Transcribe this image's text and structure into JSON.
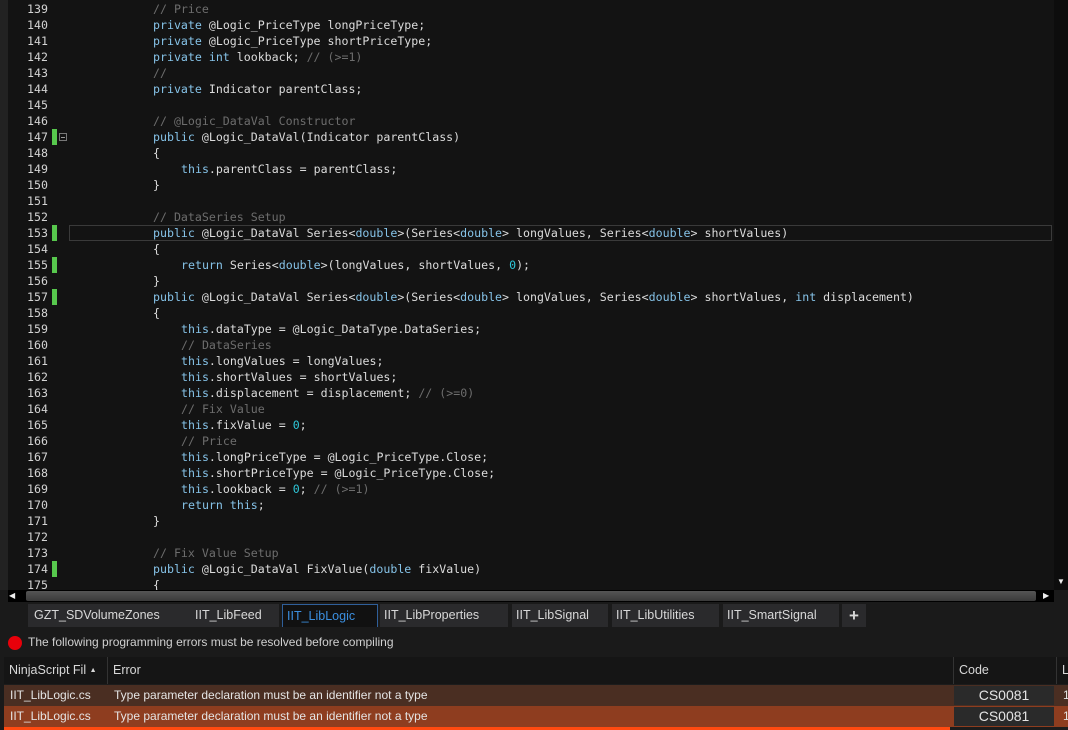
{
  "editor": {
    "lines": [
      {
        "n": "139",
        "i": 12,
        "t": [
          [
            "cm",
            "// Price"
          ]
        ]
      },
      {
        "n": "140",
        "i": 12,
        "t": [
          [
            "kw",
            "private"
          ],
          [
            "tx",
            " @Logic_PriceType longPriceType;"
          ]
        ]
      },
      {
        "n": "141",
        "i": 12,
        "t": [
          [
            "kw",
            "private"
          ],
          [
            "tx",
            " @Logic_PriceType shortPriceType;"
          ]
        ]
      },
      {
        "n": "142",
        "i": 12,
        "t": [
          [
            "kw",
            "private int"
          ],
          [
            "tx",
            " lookback; "
          ],
          [
            "cm",
            "// (>=1)"
          ]
        ]
      },
      {
        "n": "143",
        "i": 12,
        "t": [
          [
            "cm",
            "//"
          ]
        ]
      },
      {
        "n": "144",
        "i": 12,
        "t": [
          [
            "kw",
            "private"
          ],
          [
            "tx",
            " Indicator parentClass;"
          ]
        ]
      },
      {
        "n": "145",
        "i": 0,
        "t": []
      },
      {
        "n": "146",
        "i": 12,
        "t": [
          [
            "cm",
            "// @Logic_DataVal Constructor"
          ]
        ]
      },
      {
        "n": "147",
        "i": 12,
        "mark": true,
        "fold": true,
        "t": [
          [
            "kw",
            "public"
          ],
          [
            "tx",
            " @Logic_DataVal(Indicator parentClass)"
          ]
        ]
      },
      {
        "n": "148",
        "i": 12,
        "t": [
          [
            "tx",
            "{"
          ]
        ]
      },
      {
        "n": "149",
        "i": 16,
        "t": [
          [
            "kw",
            "this"
          ],
          [
            "tx",
            ".parentClass = parentClass;"
          ]
        ]
      },
      {
        "n": "150",
        "i": 12,
        "t": [
          [
            "tx",
            "}"
          ]
        ]
      },
      {
        "n": "151",
        "i": 0,
        "t": []
      },
      {
        "n": "152",
        "i": 12,
        "t": [
          [
            "cm",
            "// DataSeries Setup"
          ]
        ]
      },
      {
        "n": "153",
        "i": 12,
        "mark": true,
        "current": true,
        "t": [
          [
            "kw",
            "public"
          ],
          [
            "tx",
            " @Logic_DataVal Series<"
          ],
          [
            "kw",
            "double"
          ],
          [
            "tx",
            ">(Series<"
          ],
          [
            "kw",
            "double"
          ],
          [
            "tx",
            "> longValues, Series<"
          ],
          [
            "kw",
            "double"
          ],
          [
            "tx",
            "> shortValues)"
          ]
        ]
      },
      {
        "n": "154",
        "i": 12,
        "t": [
          [
            "tx",
            "{"
          ]
        ]
      },
      {
        "n": "155",
        "i": 16,
        "mark": true,
        "t": [
          [
            "kw",
            "return"
          ],
          [
            "tx",
            " Series<"
          ],
          [
            "kw",
            "double"
          ],
          [
            "tx",
            ">(longValues, shortValues, "
          ],
          [
            "num",
            "0"
          ],
          [
            "tx",
            ");"
          ]
        ]
      },
      {
        "n": "156",
        "i": 12,
        "t": [
          [
            "tx",
            "}"
          ]
        ]
      },
      {
        "n": "157",
        "i": 12,
        "mark": true,
        "t": [
          [
            "kw",
            "public"
          ],
          [
            "tx",
            " @Logic_DataVal Series<"
          ],
          [
            "kw",
            "double"
          ],
          [
            "tx",
            ">(Series<"
          ],
          [
            "kw",
            "double"
          ],
          [
            "tx",
            "> longValues, Series<"
          ],
          [
            "kw",
            "double"
          ],
          [
            "tx",
            "> shortValues, "
          ],
          [
            "kw",
            "int"
          ],
          [
            "tx",
            " displacement)"
          ]
        ]
      },
      {
        "n": "158",
        "i": 12,
        "t": [
          [
            "tx",
            "{"
          ]
        ]
      },
      {
        "n": "159",
        "i": 16,
        "t": [
          [
            "kw",
            "this"
          ],
          [
            "tx",
            ".dataType = @Logic_DataType.DataSeries;"
          ]
        ]
      },
      {
        "n": "160",
        "i": 16,
        "t": [
          [
            "cm",
            "// DataSeries"
          ]
        ]
      },
      {
        "n": "161",
        "i": 16,
        "t": [
          [
            "kw",
            "this"
          ],
          [
            "tx",
            ".longValues = longValues;"
          ]
        ]
      },
      {
        "n": "162",
        "i": 16,
        "t": [
          [
            "kw",
            "this"
          ],
          [
            "tx",
            ".shortValues = shortValues;"
          ]
        ]
      },
      {
        "n": "163",
        "i": 16,
        "t": [
          [
            "kw",
            "this"
          ],
          [
            "tx",
            ".displacement = displacement; "
          ],
          [
            "cm",
            "// (>=0)"
          ]
        ]
      },
      {
        "n": "164",
        "i": 16,
        "t": [
          [
            "cm",
            "// Fix Value"
          ]
        ]
      },
      {
        "n": "165",
        "i": 16,
        "t": [
          [
            "kw",
            "this"
          ],
          [
            "tx",
            ".fixValue = "
          ],
          [
            "num",
            "0"
          ],
          [
            "tx",
            ";"
          ]
        ]
      },
      {
        "n": "166",
        "i": 16,
        "t": [
          [
            "cm",
            "// Price"
          ]
        ]
      },
      {
        "n": "167",
        "i": 16,
        "t": [
          [
            "kw",
            "this"
          ],
          [
            "tx",
            ".longPriceType = @Logic_PriceType.Close;"
          ]
        ]
      },
      {
        "n": "168",
        "i": 16,
        "t": [
          [
            "kw",
            "this"
          ],
          [
            "tx",
            ".shortPriceType = @Logic_PriceType.Close;"
          ]
        ]
      },
      {
        "n": "169",
        "i": 16,
        "t": [
          [
            "kw",
            "this"
          ],
          [
            "tx",
            ".lookback = "
          ],
          [
            "num",
            "0"
          ],
          [
            "tx",
            "; "
          ],
          [
            "cm",
            "// (>=1)"
          ]
        ]
      },
      {
        "n": "170",
        "i": 16,
        "t": [
          [
            "kw",
            "return this"
          ],
          [
            "tx",
            ";"
          ]
        ]
      },
      {
        "n": "171",
        "i": 12,
        "t": [
          [
            "tx",
            "}"
          ]
        ]
      },
      {
        "n": "172",
        "i": 0,
        "t": []
      },
      {
        "n": "173",
        "i": 12,
        "t": [
          [
            "cm",
            "// Fix Value Setup"
          ]
        ]
      },
      {
        "n": "174",
        "i": 12,
        "mark": true,
        "t": [
          [
            "kw",
            "public"
          ],
          [
            "tx",
            " @Logic_DataVal FixValue("
          ],
          [
            "kw",
            "double"
          ],
          [
            "tx",
            " fixValue)"
          ]
        ]
      },
      {
        "n": "175",
        "i": 12,
        "t": [
          [
            "tx",
            "{"
          ]
        ]
      }
    ]
  },
  "tabs": [
    {
      "label": "GZT_SDVolumeZones",
      "active": false
    },
    {
      "label": "IIT_LibFeed",
      "active": false
    },
    {
      "label": "IIT_LibLogic",
      "active": true
    },
    {
      "label": "IIT_LibProperties",
      "active": false
    },
    {
      "label": "IIT_LibSignal",
      "active": false
    },
    {
      "label": "IIT_LibUtilities",
      "active": false
    },
    {
      "label": "IIT_SmartSignal",
      "active": false
    }
  ],
  "add_tab_label": "+",
  "error_banner": "The following programming errors must be resolved before compiling",
  "grid": {
    "headers": {
      "file": "NinjaScript Fil",
      "error": "Error",
      "code": "Code",
      "line": "L"
    },
    "sort_icon": "▲",
    "rows": [
      {
        "file": "IIT_LibLogic.cs",
        "error": "Type parameter declaration must be an identifier not a type",
        "code": "CS0081",
        "line": "1"
      },
      {
        "file": "IIT_LibLogic.cs",
        "error": "Type parameter declaration must be an identifier not a type",
        "code": "CS0081",
        "line": "1"
      }
    ]
  },
  "colors": {
    "keyword": "#86c3e8",
    "comment": "#6d6d6d",
    "number": "#2ec7d8",
    "active_tab": "#3b8fe0",
    "error_icon": "#e8000a",
    "row1": "#4a2e22",
    "row2": "#8e3d1f",
    "row3": "#ff4a10",
    "change_marker": "#57c84d"
  }
}
